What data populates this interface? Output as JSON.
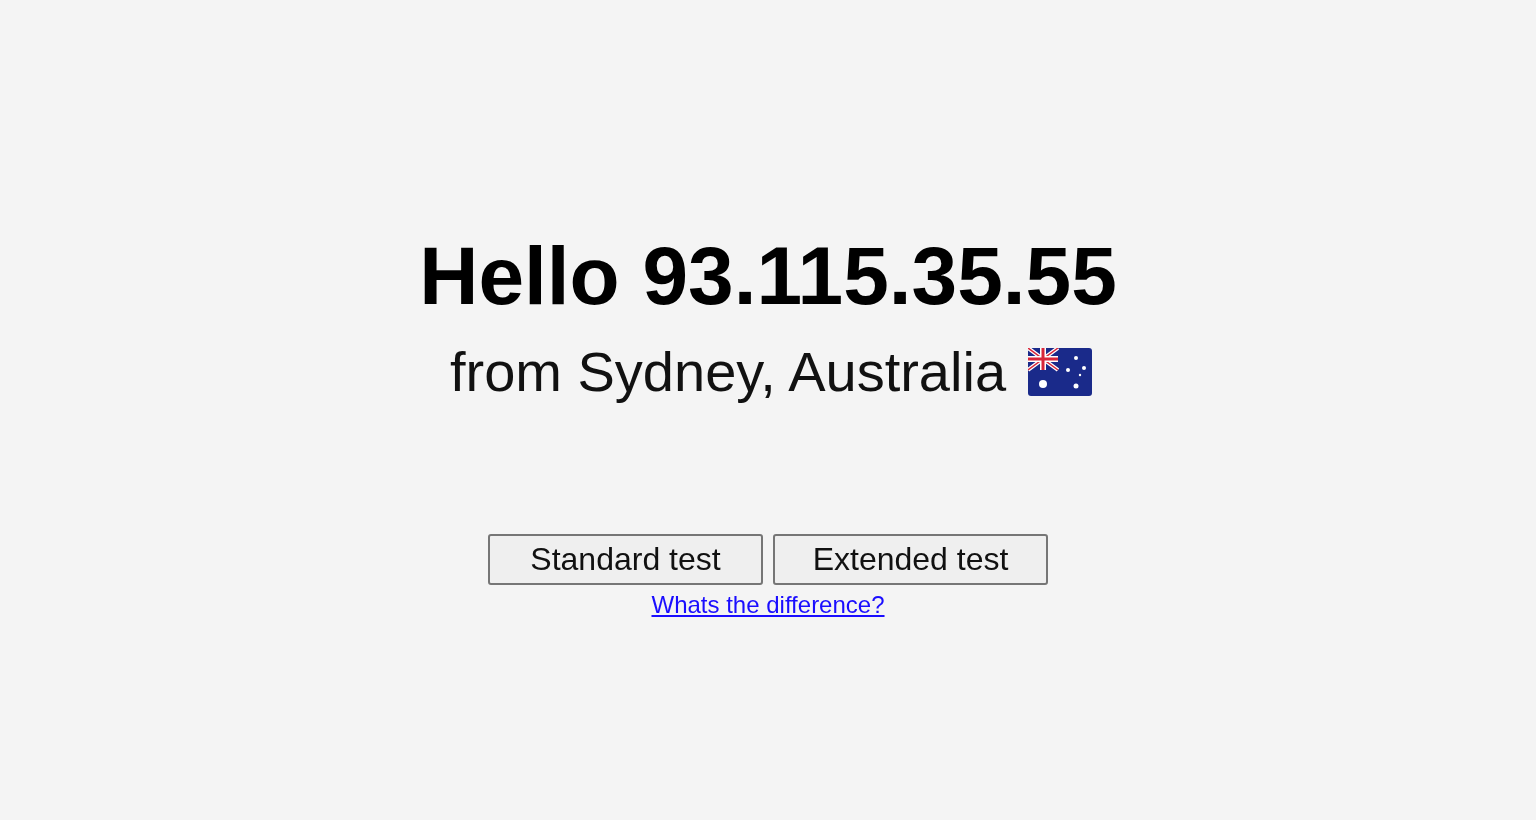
{
  "heading": "Hello 93.115.35.55",
  "location": "from Sydney, Australia",
  "buttons": [
    {
      "label": "Standard test"
    },
    {
      "label": "Extended test"
    }
  ],
  "link": "Whats the difference?"
}
